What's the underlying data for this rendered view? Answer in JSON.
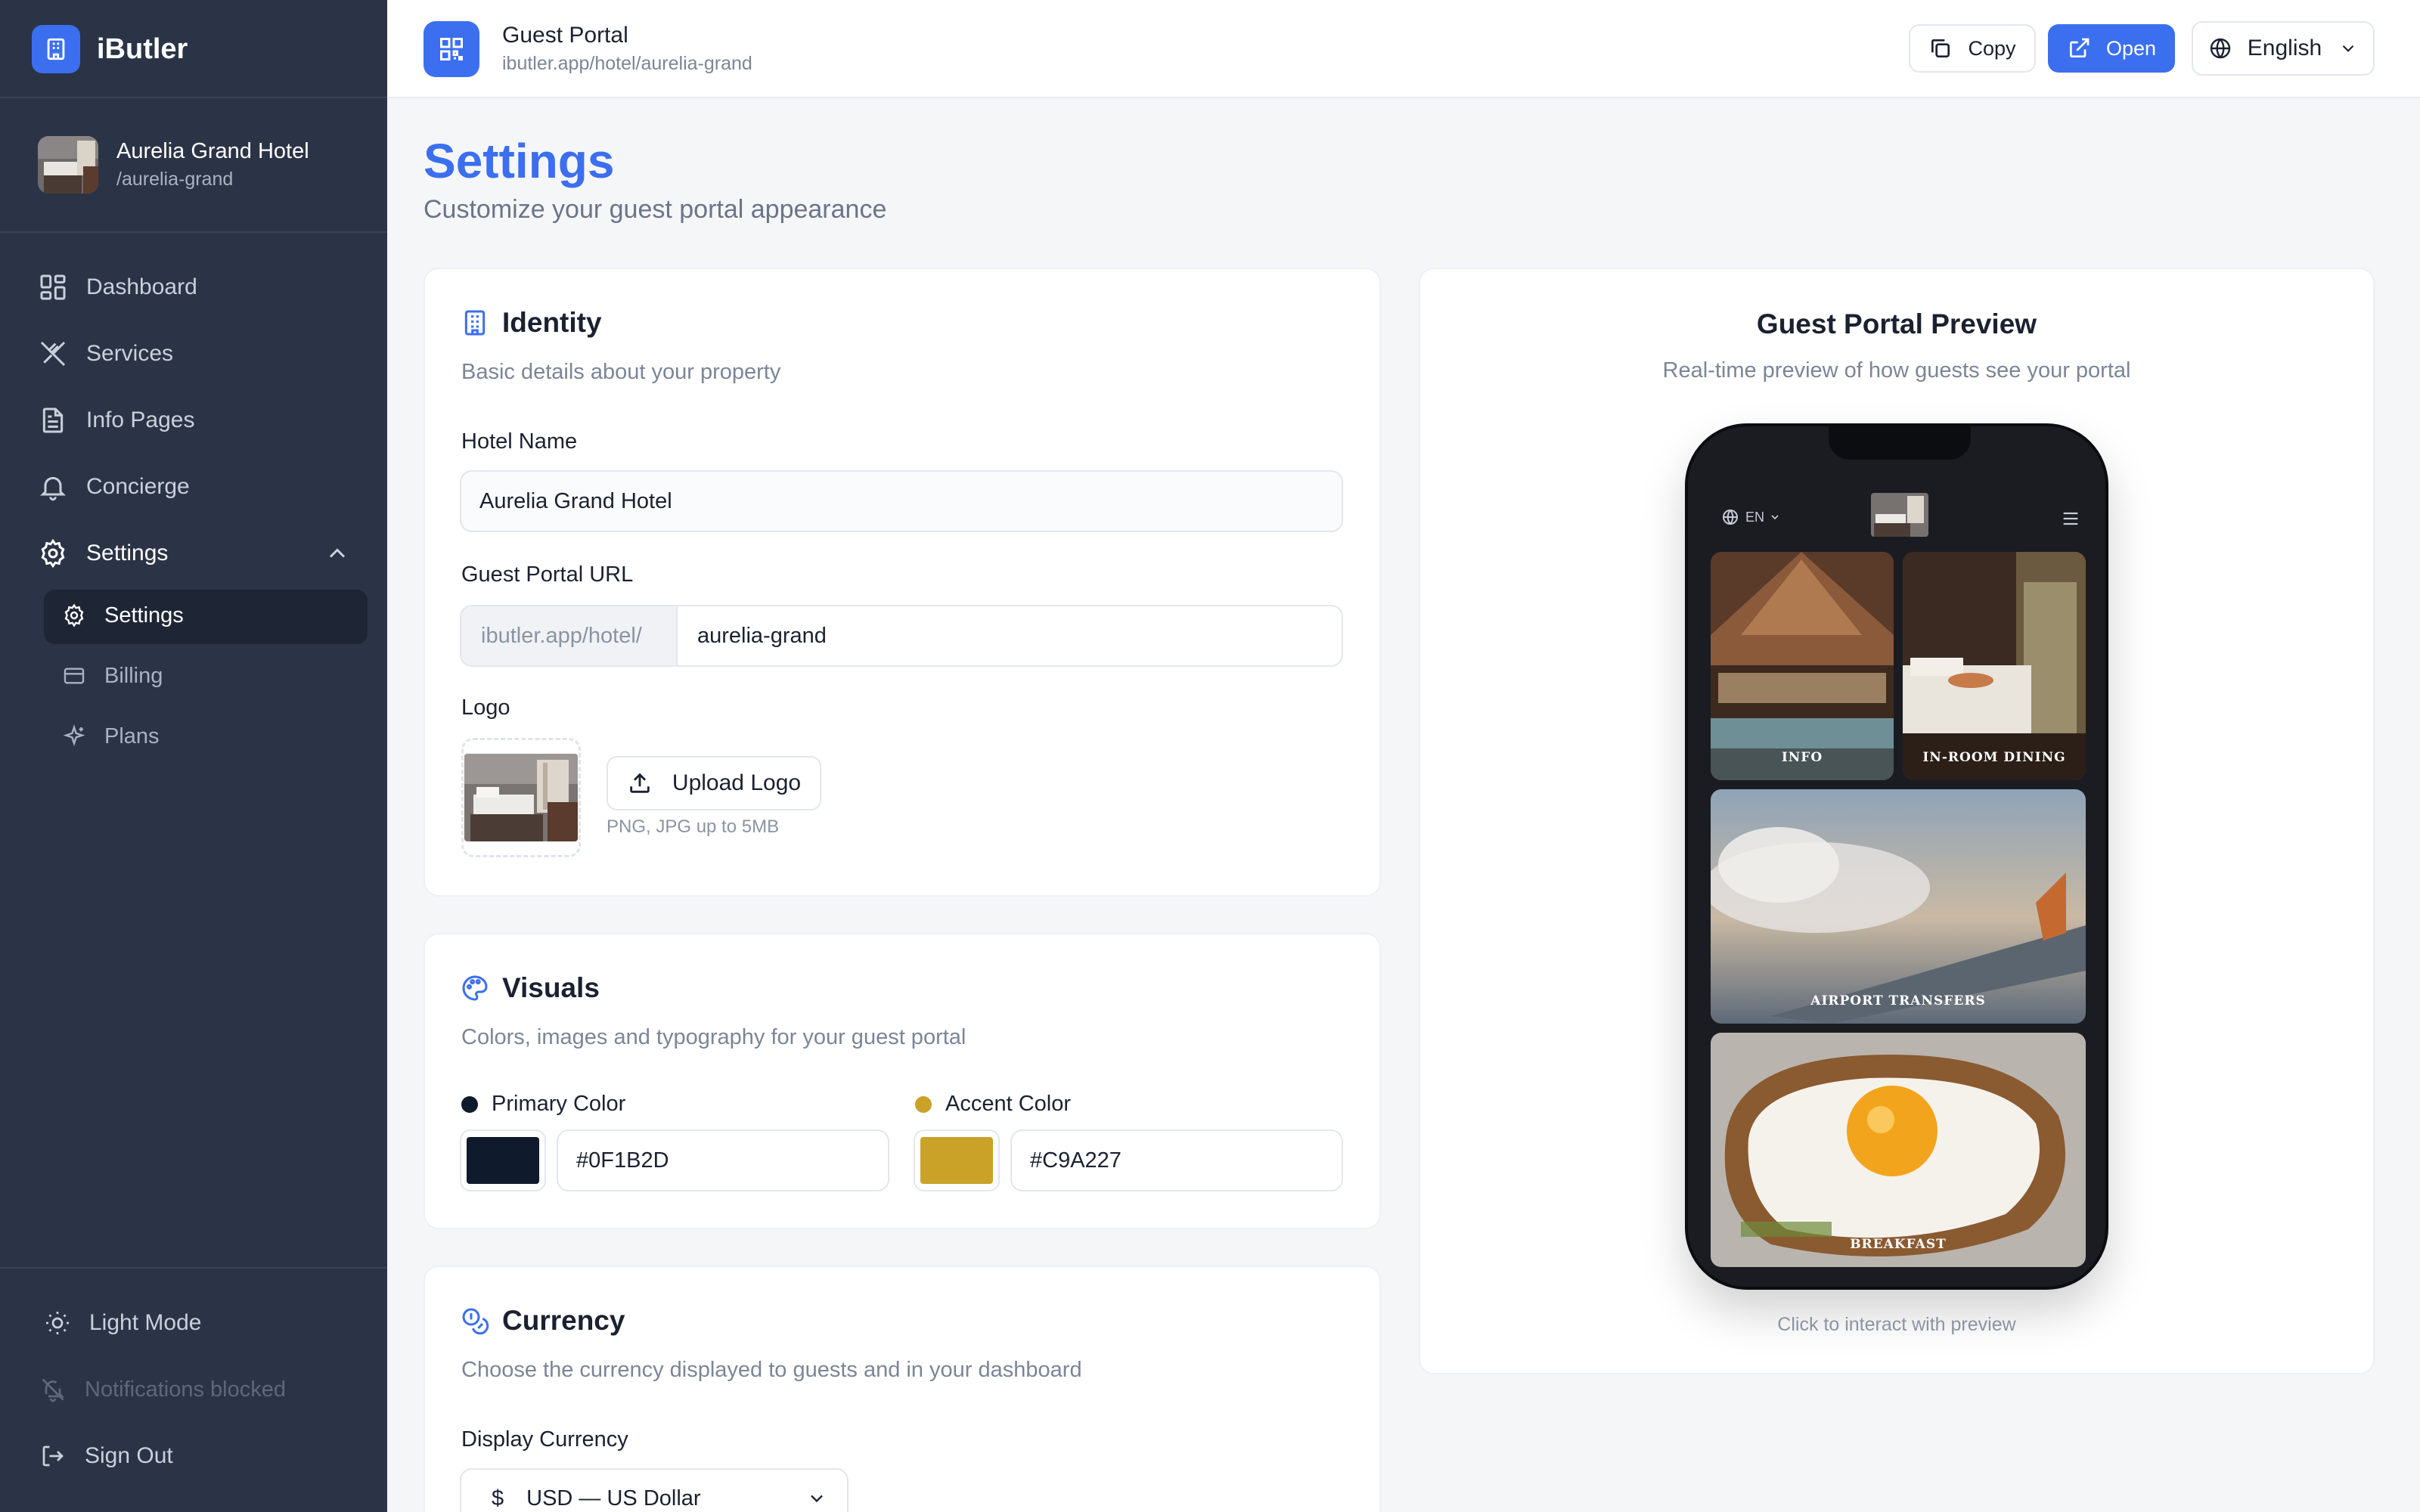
{
  "brand": {
    "name": "iButler"
  },
  "hotel": {
    "name": "Aurelia Grand Hotel",
    "slug": "/aurelia-grand"
  },
  "nav": {
    "dashboard": "Dashboard",
    "services": "Services",
    "info_pages": "Info Pages",
    "concierge": "Concierge",
    "settings": "Settings",
    "sub": {
      "settings": "Settings",
      "billing": "Billing",
      "plans": "Plans"
    }
  },
  "footer": {
    "light_mode": "Light Mode",
    "notifications": "Notifications blocked",
    "sign_out": "Sign Out"
  },
  "topbar": {
    "title": "Guest Portal",
    "url": "ibutler.app/hotel/aurelia-grand",
    "copy": "Copy",
    "open": "Open",
    "language": "English"
  },
  "page": {
    "title": "Settings",
    "subtitle": "Customize your guest portal appearance"
  },
  "identity": {
    "title": "Identity",
    "desc": "Basic details about your property",
    "hotel_name_label": "Hotel Name",
    "hotel_name_value": "Aurelia Grand Hotel",
    "url_label": "Guest Portal URL",
    "url_prefix": "ibutler.app/hotel/",
    "url_value": "aurelia-grand",
    "logo_label": "Logo",
    "upload_label": "Upload Logo",
    "upload_hint": "PNG, JPG up to 5MB"
  },
  "visuals": {
    "title": "Visuals",
    "desc": "Colors, images and typography for your guest portal",
    "primary_label": "Primary Color",
    "primary_value": "#0F1B2D",
    "accent_label": "Accent Color",
    "accent_value": "#C9A227"
  },
  "currency": {
    "title": "Currency",
    "desc": "Choose the currency displayed to guests and in your dashboard",
    "display_label": "Display Currency",
    "symbol": "$",
    "value": "USD — US Dollar"
  },
  "preview": {
    "title": "Guest Portal Preview",
    "desc": "Real-time preview of how guests see your portal",
    "lang": "EN",
    "tiles": [
      "INFO",
      "IN-ROOM DINING",
      "AIRPORT TRANSFERS",
      "BREAKFAST"
    ],
    "hint": "Click to interact with preview"
  },
  "colors": {
    "accent": "#3b6ff0",
    "sidebar": "#2b3446",
    "primary_swatch": "#0F1B2D",
    "accent_swatch": "#C9A227"
  }
}
